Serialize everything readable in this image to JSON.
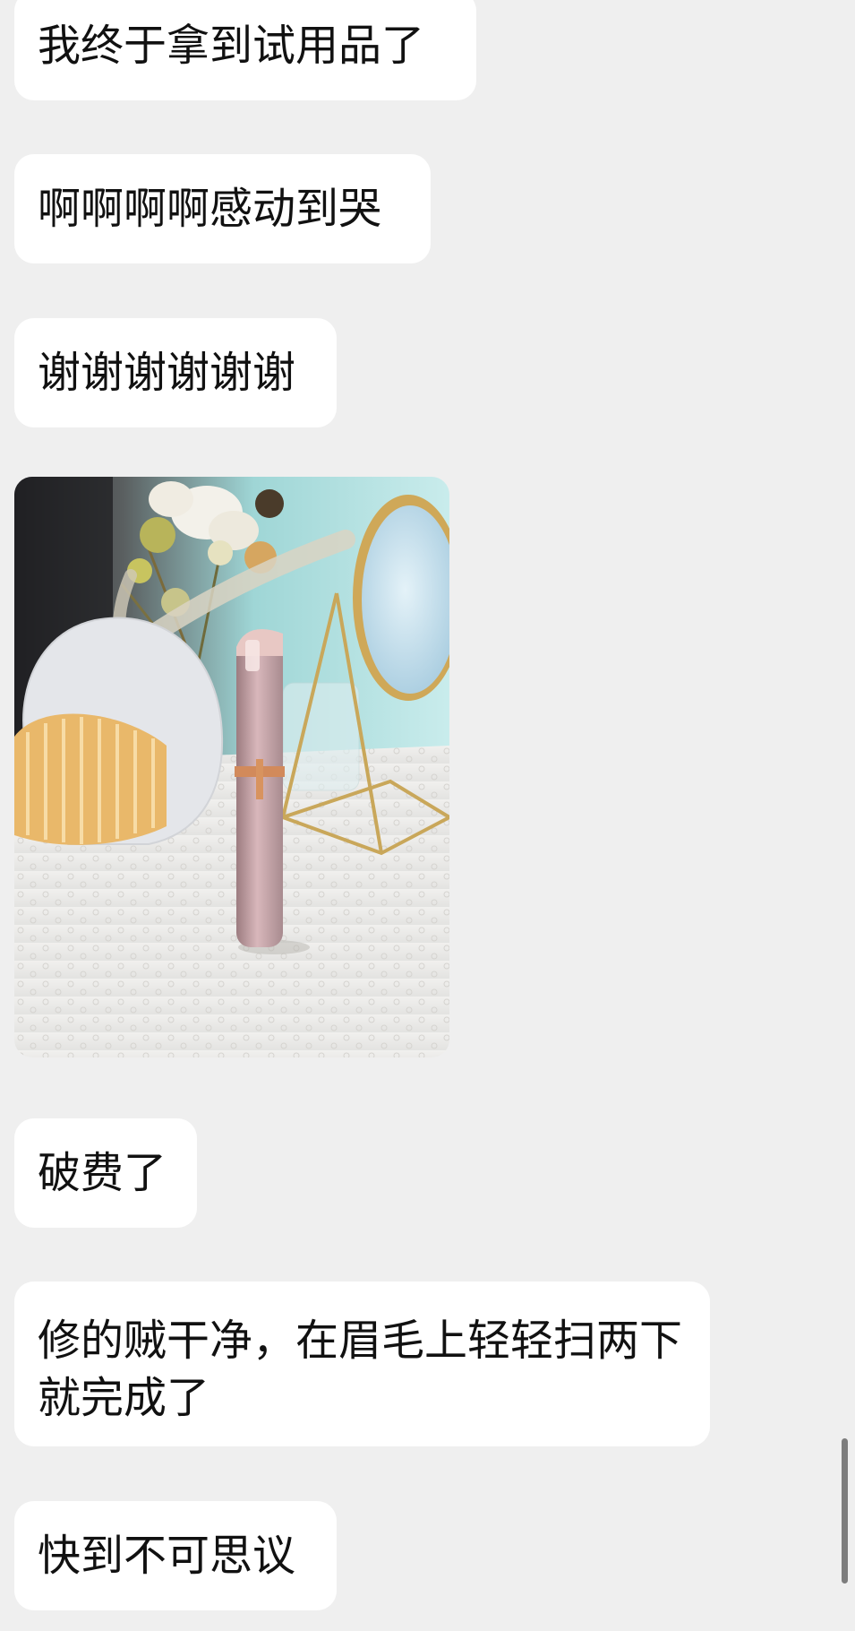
{
  "messages": [
    {
      "type": "text",
      "text": "我终于拿到试用品了"
    },
    {
      "type": "text",
      "text": "啊啊啊啊感动到哭"
    },
    {
      "type": "text",
      "text": "谢谢谢谢谢谢"
    },
    {
      "type": "image",
      "icon": "product-photo"
    },
    {
      "type": "text",
      "text": "破费了"
    },
    {
      "type": "text",
      "text": "修的贼干净，在眉毛上轻轻扫两下就完成了"
    },
    {
      "type": "text",
      "text": "快到不可思议"
    }
  ],
  "colors": {
    "background": "#efefef",
    "bubble": "#ffffff",
    "text": "#111111",
    "scrollbar": "#7d7d7d"
  }
}
